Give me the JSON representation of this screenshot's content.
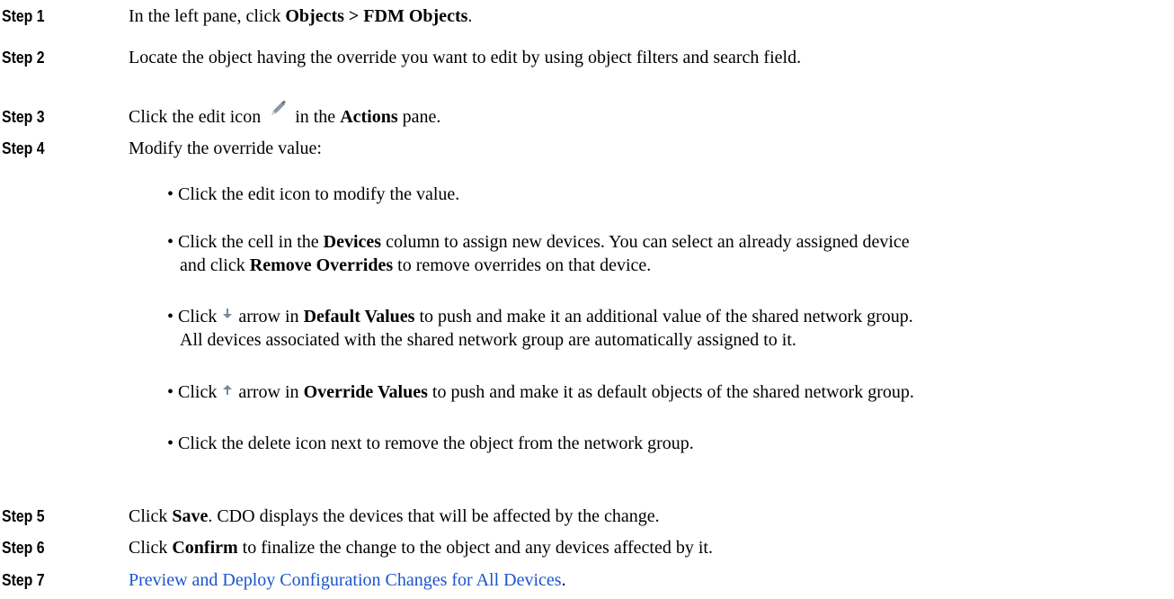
{
  "steps": [
    {
      "label": "Step 1",
      "pre": "In the left pane, click ",
      "bold": "Objects > FDM Objects",
      "post": "."
    },
    {
      "label": "Step 2",
      "text": "Locate the object having the override you want to edit by using object filters and search field."
    },
    {
      "label": "Step 3",
      "pre": "Click the edit icon ",
      "icon": "pencil-edit-icon",
      "mid": " in the ",
      "bold": "Actions",
      "post": " pane."
    },
    {
      "label": "Step 4",
      "text": "Modify the override value:"
    },
    {
      "label": "Step 5",
      "pre": "Click ",
      "bold": "Save",
      "post": ". CDO displays the devices that will be affected by the change."
    },
    {
      "label": "Step 6",
      "pre": "Click ",
      "bold": "Confirm",
      "post": " to finalize the change to the object and any devices affected by it."
    },
    {
      "label": "Step 7",
      "link": "Preview and Deploy Configuration Changes for All Devices",
      "post": "."
    }
  ],
  "bullets": [
    {
      "text": "Click the edit icon to modify the value."
    },
    {
      "pre": "Click the cell in the ",
      "bold": "Devices",
      "post": " column to assign new devices. You can select an already assigned device",
      "line2_pre": "and click ",
      "line2_bold": "Remove Overrides",
      "line2_post": " to remove overrides on that device."
    },
    {
      "pre": "Click ",
      "icon": "arrow-down-icon",
      "mid": " arrow in ",
      "bold": "Default Values",
      "post": " to push and make it an additional value of the shared network group.",
      "line2": "All devices associated with the shared network group are automatically assigned to it."
    },
    {
      "pre": "Click ",
      "icon": "arrow-up-icon",
      "mid": " arrow in ",
      "bold": "Override Values",
      "post": " to push and make it as default objects of the shared network group."
    },
    {
      "text": "Click the delete icon next to remove the object from the network group."
    }
  ],
  "bullet_char": "•",
  "colors": {
    "link": "#1a55cc",
    "icon": "#7a8a99"
  }
}
